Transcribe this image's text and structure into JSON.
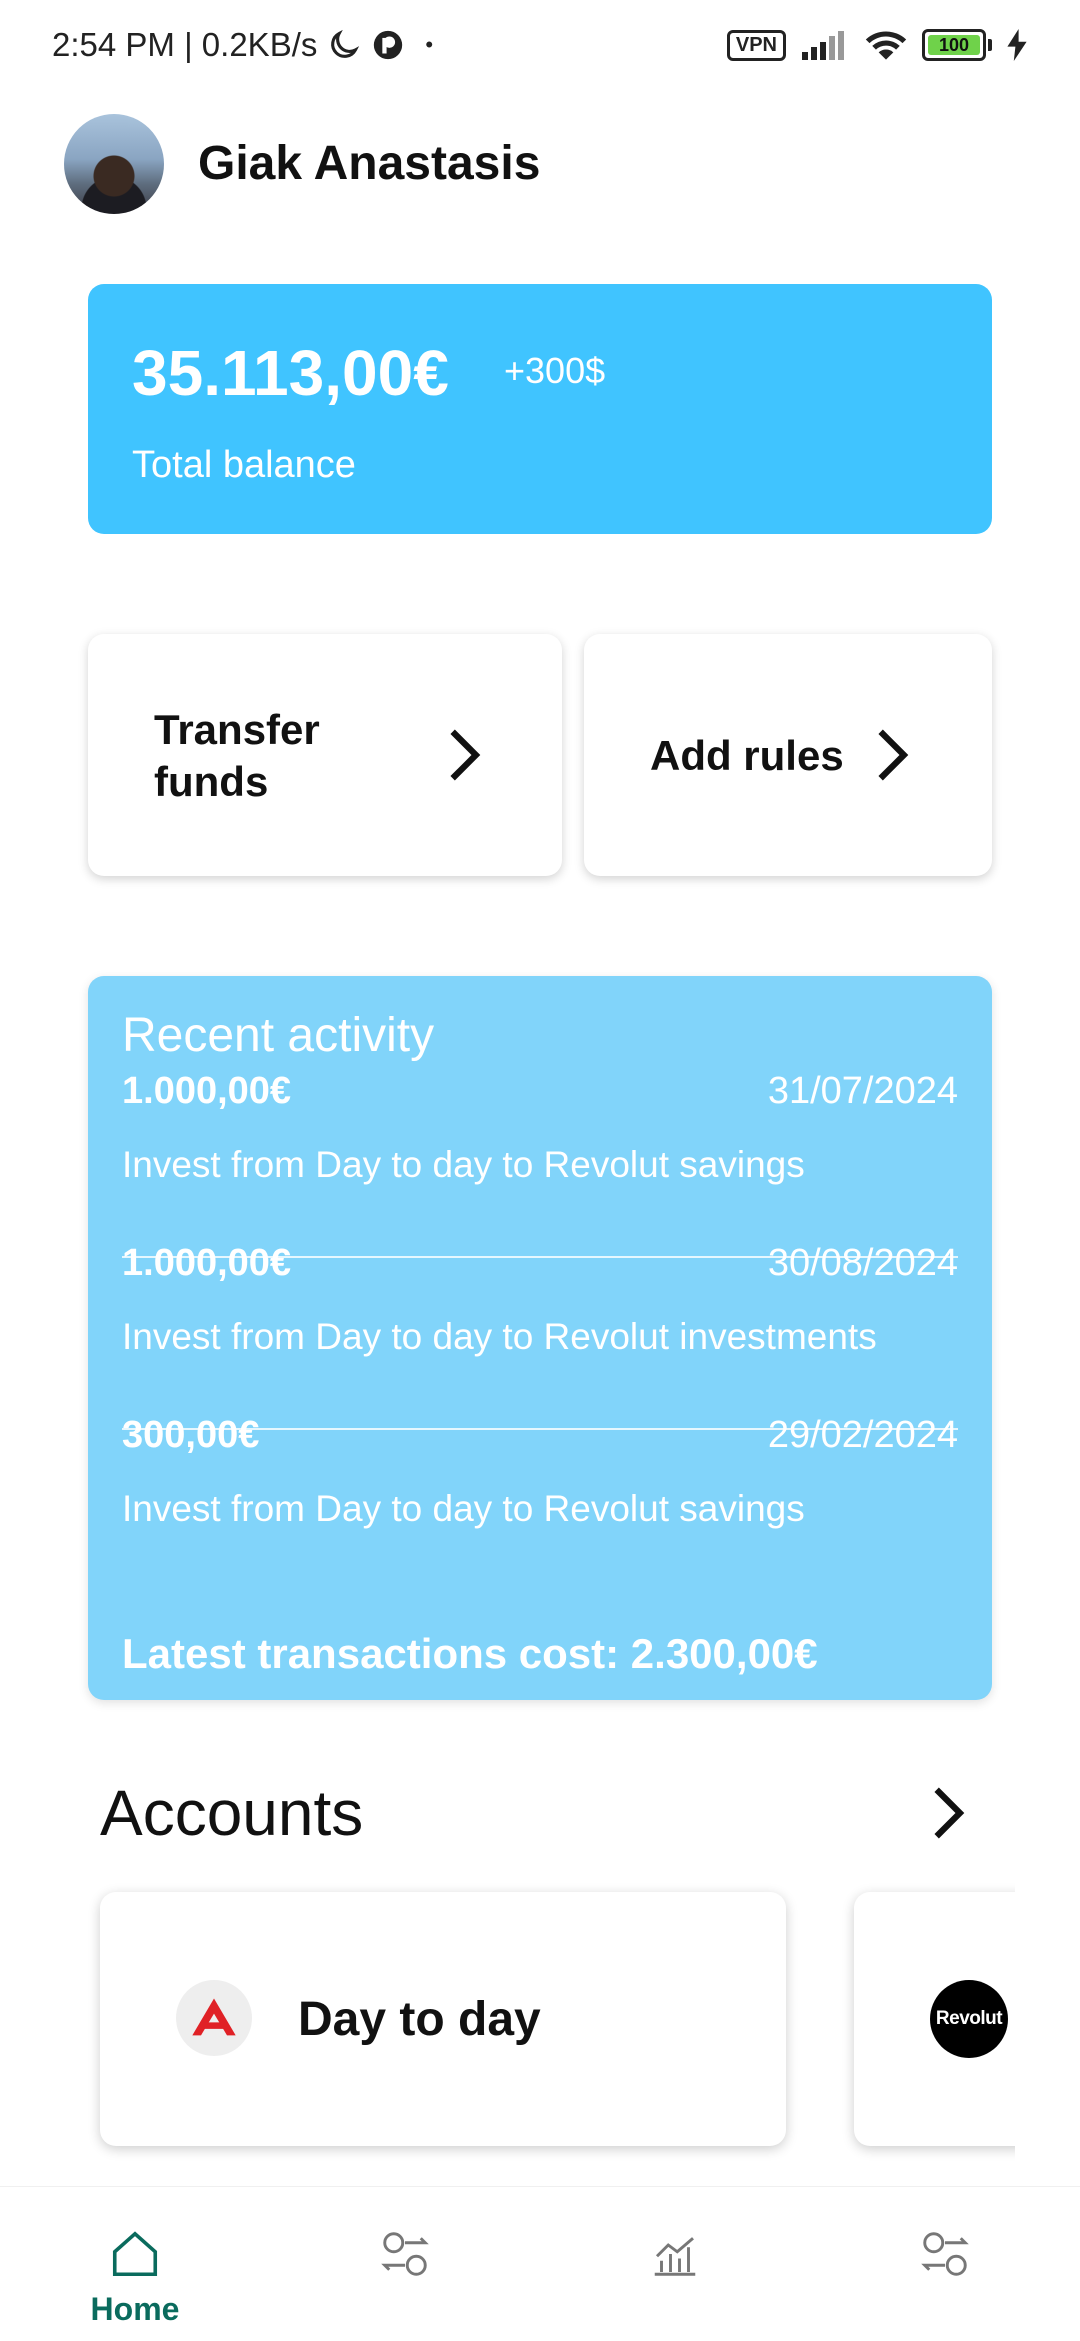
{
  "status_bar": {
    "time_speed": "2:54 PM | 0.2KB/s",
    "dot": "•",
    "vpn": "VPN",
    "battery": "100"
  },
  "header": {
    "user_name": "Giak Anastasis"
  },
  "balance": {
    "amount": "35.113,00€",
    "change": "+300$",
    "label": "Total balance"
  },
  "actions": {
    "transfer_label": "Transfer funds",
    "rules_label": "Add rules"
  },
  "recent_activity": {
    "title": "Recent activity",
    "transactions": [
      {
        "amount": "1.000,00€",
        "date": "31/07/2024",
        "description": "Invest from Day to day to Revolut savings"
      },
      {
        "amount": "1.000,00€",
        "date": "30/08/2024",
        "description": "Invest from Day to day to Revolut investments"
      },
      {
        "amount": "300,00€",
        "date": "29/02/2024",
        "description": "Invest from Day to day to Revolut savings"
      }
    ],
    "total": "Latest transactions cost: 2.300,00€"
  },
  "accounts": {
    "title": "Accounts",
    "items": [
      {
        "name": "Day to day",
        "logo": "bank-logo-icon"
      },
      {
        "name": "",
        "logo_text": "Revolut"
      }
    ]
  },
  "bottom_nav": {
    "items": [
      {
        "label": "Home",
        "icon": "home-icon",
        "active": true
      },
      {
        "label": "",
        "icon": "exchange-icon"
      },
      {
        "label": "",
        "icon": "chart-icon"
      },
      {
        "label": "",
        "icon": "exchange-icon"
      }
    ],
    "active_color": "#0a6b5d"
  },
  "colors": {
    "balance_card": "#40c4ff",
    "activity_card": "#81d4fa"
  }
}
